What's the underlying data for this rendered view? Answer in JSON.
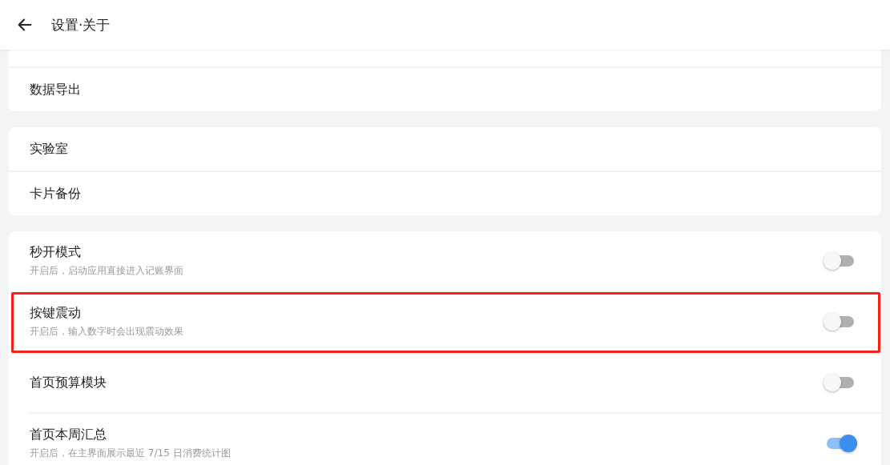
{
  "header": {
    "title": "设置·关于"
  },
  "groups": [
    {
      "items": [
        {
          "kind": "link",
          "label": "数据导出"
        }
      ]
    },
    {
      "items": [
        {
          "kind": "link",
          "label": "实验室"
        },
        {
          "kind": "link",
          "label": "卡片备份"
        }
      ]
    },
    {
      "items": [
        {
          "kind": "toggle",
          "label": "秒开模式",
          "description": "开启后，启动应用直接进入记账界面",
          "on": false,
          "highlighted": false
        },
        {
          "kind": "toggle",
          "label": "按键震动",
          "description": "开启后，输入数字时会出现震动效果",
          "on": false,
          "highlighted": true
        },
        {
          "kind": "toggle",
          "label": "首页预算模块",
          "on": false,
          "highlighted": false
        },
        {
          "kind": "toggle",
          "label": "首页本周汇总",
          "description": "开启后，在主界面展示最近 7/15 日消费统计图",
          "on": true,
          "highlighted": false
        }
      ]
    }
  ]
}
